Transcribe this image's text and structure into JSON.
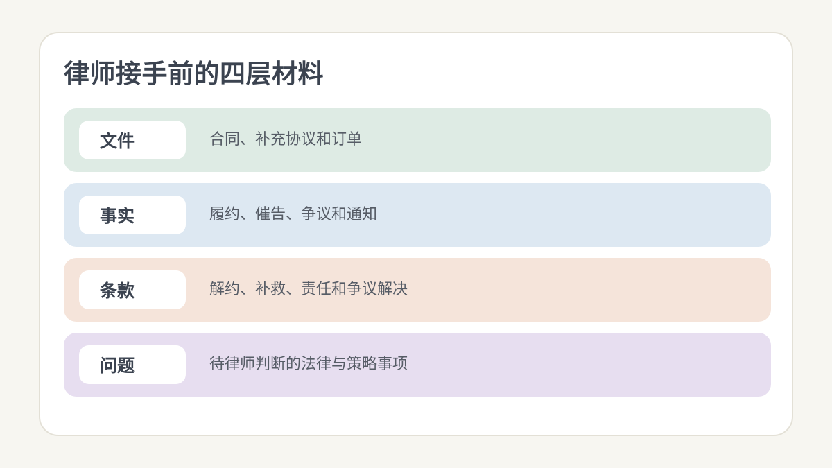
{
  "title": "律师接手前的四层材料",
  "layers": [
    {
      "tag": "文件",
      "desc": "合同、补充协议和订单",
      "color": "#deebe4"
    },
    {
      "tag": "事实",
      "desc": "履约、催告、争议和通知",
      "color": "#dde8f2"
    },
    {
      "tag": "条款",
      "desc": "解约、补救、责任和争议解决",
      "color": "#f5e4da"
    },
    {
      "tag": "问题",
      "desc": "待律师判断的法律与策略事项",
      "color": "#e7def0"
    }
  ],
  "colors": {
    "page_background": "#f7f6f1",
    "card_background": "#ffffff",
    "card_border": "#e3e0d6",
    "title_text": "#3b4350",
    "description_text": "#565c66"
  }
}
